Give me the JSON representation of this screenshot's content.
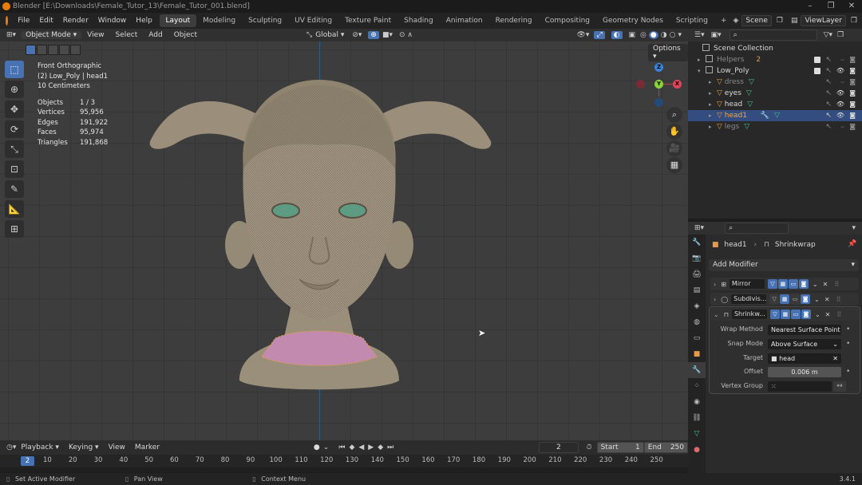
{
  "window": {
    "title": "Blender [E:\\Downloads\\Female_Tutor_13\\Female_Tutor_001.blend]"
  },
  "menu": [
    "File",
    "Edit",
    "Render",
    "Window",
    "Help"
  ],
  "workspaces": [
    "Layout",
    "Modeling",
    "Sculpting",
    "UV Editing",
    "Texture Paint",
    "Shading",
    "Animation",
    "Rendering",
    "Compositing",
    "Geometry Nodes",
    "Scripting"
  ],
  "workspace_add": "+",
  "scene": "Scene",
  "view_layer": "ViewLayer",
  "viewport_header": {
    "mode": "Object Mode",
    "menus": [
      "View",
      "Select",
      "Add",
      "Object"
    ],
    "transform": "Global",
    "options": "Options"
  },
  "viewport_info": {
    "view": "Front Orthographic",
    "collection": "(2) Low_Poly | head1",
    "scale": "10 Centimeters"
  },
  "stats": [
    {
      "label": "Objects",
      "value": "1 / 3"
    },
    {
      "label": "Vertices",
      "value": "95,956"
    },
    {
      "label": "Edges",
      "value": "191,922"
    },
    {
      "label": "Faces",
      "value": "95,974"
    },
    {
      "label": "Triangles",
      "value": "191,868"
    }
  ],
  "gizmo": {
    "x": "X",
    "y": "Y",
    "z": "Z"
  },
  "outliner": {
    "root": "Scene Collection",
    "items": [
      {
        "name": "Helpers",
        "badge": "2"
      },
      {
        "name": "Low_Poly"
      },
      {
        "name": "dress"
      },
      {
        "name": "eyes"
      },
      {
        "name": "head"
      },
      {
        "name": "head1"
      },
      {
        "name": "legs"
      }
    ]
  },
  "properties": {
    "object": "head1",
    "modifier": "Shrinkwrap",
    "add_modifier": "Add Modifier",
    "modifiers": [
      {
        "name": "Mirror"
      },
      {
        "name": "Subdivis..."
      },
      {
        "name": "Shrinkw..."
      }
    ],
    "fields": {
      "wrap_method_label": "Wrap Method",
      "wrap_method": "Nearest Surface Point",
      "snap_mode_label": "Snap Mode",
      "snap_mode": "Above Surface",
      "target_label": "Target",
      "target": "head",
      "offset_label": "Offset",
      "offset": "0.006 m",
      "vertex_group_label": "Vertex Group"
    }
  },
  "timeline": {
    "menus": [
      "Playback",
      "Keying",
      "View",
      "Marker"
    ],
    "current_frame": "2",
    "start_label": "Start",
    "start": "1",
    "end_label": "End",
    "end": "250",
    "ticks": [
      "10",
      "20",
      "30",
      "40",
      "50",
      "60",
      "70",
      "80",
      "90",
      "100",
      "110",
      "120",
      "130",
      "140",
      "150",
      "160",
      "170",
      "180",
      "190",
      "200",
      "210",
      "220",
      "230",
      "240",
      "250"
    ]
  },
  "status": {
    "left": "Set Active Modifier",
    "middle": "Pan View",
    "right": "Context Menu",
    "version": "3.4.1"
  }
}
